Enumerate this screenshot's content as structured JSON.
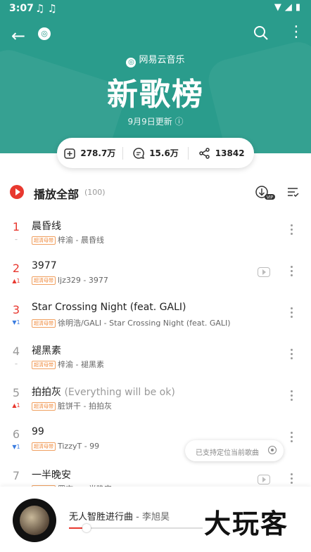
{
  "status_bar": {
    "time": "3:07",
    "notes": "♫♫",
    "icons": "▼◢▮"
  },
  "header": {
    "back_glyph": "←",
    "logo_glyph": "◎",
    "brand": "网易云音乐",
    "title": "新歌榜",
    "updated": "9月9日更新 ⓘ",
    "background_color": "#2a9c8c"
  },
  "stats": {
    "collect": "278.7万",
    "comment": "15.6万",
    "share": "13842"
  },
  "play_all": {
    "label": "播放全部",
    "count": "(100)"
  },
  "quality_badge": "超清母带",
  "songs": [
    {
      "rank": "1",
      "top": true,
      "trend": "–",
      "trend_dir": "same",
      "name": "晨昏线",
      "alias": "",
      "info": "梓渝 - 晨昏线",
      "mv": false
    },
    {
      "rank": "2",
      "top": true,
      "trend": "▲1",
      "trend_dir": "up",
      "name": "3977",
      "alias": "",
      "info": "ljz329 - 3977",
      "mv": true
    },
    {
      "rank": "3",
      "top": true,
      "trend": "▼1",
      "trend_dir": "down",
      "name": "Star Crossing Night (feat. GALI)",
      "alias": "",
      "info": "徐明浩/GALI - Star Crossing Night (feat. GALI)",
      "mv": false
    },
    {
      "rank": "4",
      "top": false,
      "trend": "–",
      "trend_dir": "same",
      "name": "褪黑素",
      "alias": "",
      "info": "梓渝 - 褪黑素",
      "mv": false
    },
    {
      "rank": "5",
      "top": false,
      "trend": "▲1",
      "trend_dir": "up",
      "name": "拍拍灰",
      "alias": "(Everything will be ok)",
      "info": "脏饼干 - 拍拍灰",
      "mv": false
    },
    {
      "rank": "6",
      "top": false,
      "trend": "▼1",
      "trend_dir": "down",
      "name": "99",
      "alias": "",
      "info": "TizzyT - 99",
      "mv": false
    },
    {
      "rank": "7",
      "top": false,
      "trend": "",
      "trend_dir": "same",
      "name": "一半晚安",
      "alias": "",
      "info": "罗言 - 一半晚安",
      "mv": true
    }
  ],
  "locate_tip": "已支持定位当前歌曲",
  "player": {
    "song": "无人智胜进行曲",
    "artist": "- 李旭昊",
    "progress": 0.13
  },
  "watermark": "大玩客"
}
